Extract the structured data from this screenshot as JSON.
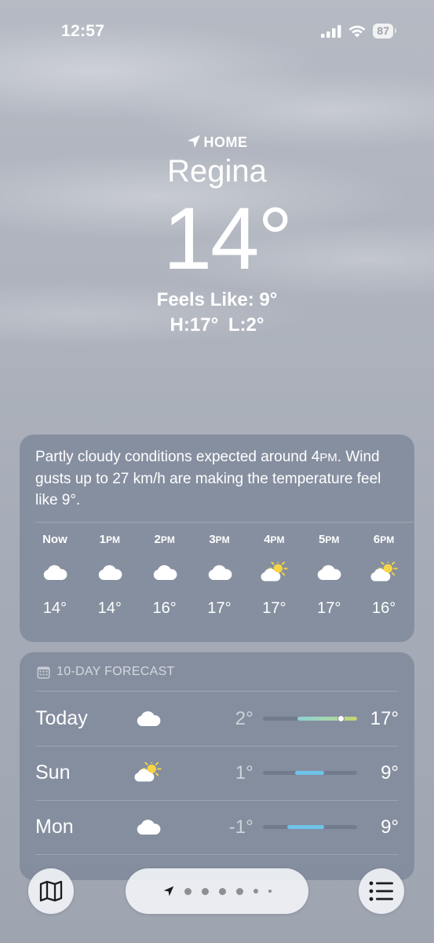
{
  "status": {
    "time": "12:57",
    "battery": "87"
  },
  "header": {
    "location_label": "HOME",
    "city": "Regina",
    "temperature": "14°",
    "feels_like": "Feels Like: 9°",
    "high_low": "H:17° L:2°"
  },
  "hourly": {
    "summary_part1": "Partly cloudy conditions expected around 4",
    "summary_pm": "PM",
    "summary_part2": ". Wind gusts up to 27 km/h are making the temperature feel like 9°.",
    "hours": [
      {
        "label": "Now",
        "suffix": "",
        "icon": "cloud-icon",
        "temp": "14°"
      },
      {
        "label": "1",
        "suffix": "PM",
        "icon": "cloud-icon",
        "temp": "14°"
      },
      {
        "label": "2",
        "suffix": "PM",
        "icon": "cloud-icon",
        "temp": "16°"
      },
      {
        "label": "3",
        "suffix": "PM",
        "icon": "cloud-icon",
        "temp": "17°"
      },
      {
        "label": "4",
        "suffix": "PM",
        "icon": "partly-sunny-icon",
        "temp": "17°"
      },
      {
        "label": "5",
        "suffix": "PM",
        "icon": "cloud-icon",
        "temp": "17°"
      },
      {
        "label": "6",
        "suffix": "PM",
        "icon": "partly-sunny-icon",
        "temp": "16°"
      }
    ]
  },
  "forecast": {
    "title": "10-DAY FORECAST",
    "days": [
      {
        "day": "Today",
        "icon": "cloud-icon",
        "low": "2°",
        "high": "17°",
        "range_start": 0.37,
        "range_end": 1.0,
        "current": 0.83
      },
      {
        "day": "Sun",
        "icon": "partly-sunny-icon",
        "low": "1°",
        "high": "9°",
        "range_start": 0.34,
        "range_end": 0.65
      },
      {
        "day": "Mon",
        "icon": "cloud-icon",
        "low": "-1°",
        "high": "9°",
        "range_start": 0.26,
        "range_end": 0.65
      }
    ]
  },
  "bottom_bar": {
    "pages": 7
  },
  "colors": {
    "card": "#7c8798",
    "bar_today": "#a8d8a8",
    "bar_blue": "#6fc3e8",
    "sun": "#f5d547"
  }
}
